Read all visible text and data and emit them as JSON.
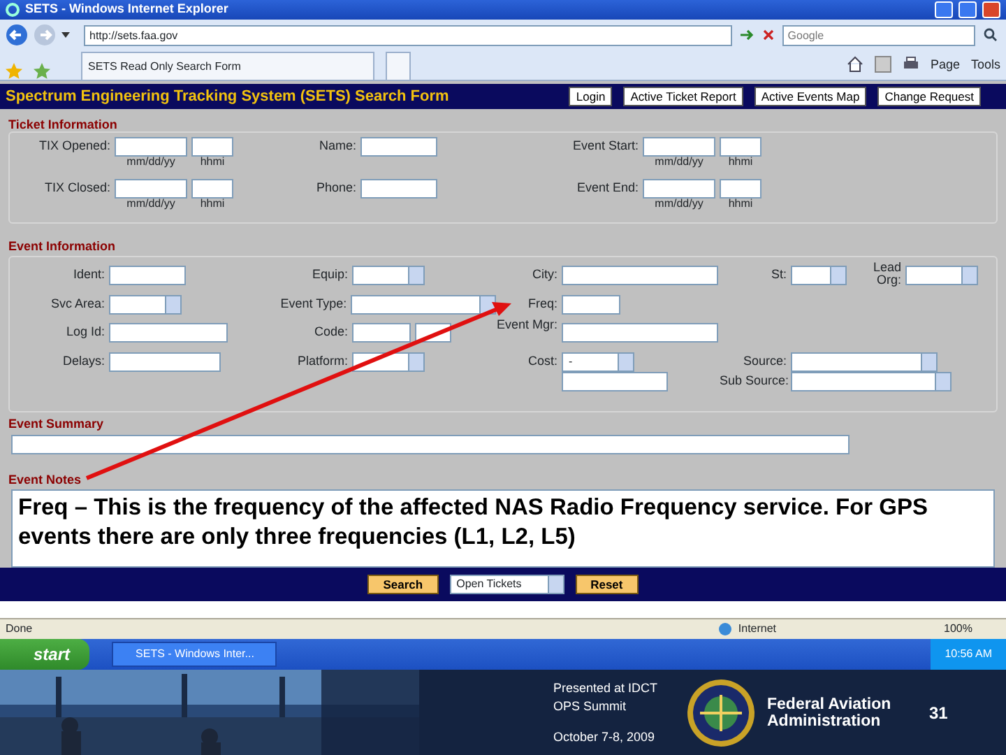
{
  "window": {
    "title": "SETS - Windows Internet Explorer",
    "address": "http://sets.faa.gov",
    "search_placeholder": "Google",
    "tab": "SETS Read Only Search Form",
    "toolbar": [
      "Page",
      "Tools"
    ]
  },
  "header": {
    "title": "Spectrum Engineering Tracking System (SETS) Search Form",
    "buttons": [
      "Login",
      "Active Ticket Report",
      "Active Events Map",
      "Change Request"
    ]
  },
  "ticket_information": {
    "title": "Ticket Information",
    "rows": [
      [
        {
          "label": "TIX Opened:",
          "kind": "datetime",
          "hints": [
            "mm/dd/yy",
            "hhmi"
          ]
        },
        {
          "label": "Name:",
          "kind": "text"
        },
        {
          "label": "Event Start:",
          "kind": "datetime",
          "hints": [
            "mm/dd/yy",
            "hhmi"
          ]
        }
      ],
      [
        {
          "label": "TIX Closed:",
          "kind": "datetime",
          "hints": [
            "mm/dd/yy",
            "hhmi"
          ]
        },
        {
          "label": "Phone:",
          "kind": "text"
        },
        {
          "label": "Event End:",
          "kind": "datetime",
          "hints": [
            "mm/dd/yy",
            "hhmi"
          ]
        }
      ]
    ]
  },
  "event_information": {
    "title": "Event Information",
    "rows": [
      [
        {
          "label": "Ident:",
          "kind": "text"
        },
        {
          "label": "Equip:",
          "kind": "select"
        },
        {
          "label": "City:",
          "kind": "wide"
        },
        {
          "label": "St:",
          "kind": "small-select"
        },
        {
          "label": "Lead Org:",
          "kind": "select"
        }
      ],
      [
        {
          "label": "Svc Area:",
          "kind": "select"
        },
        {
          "label": "Event Type:",
          "kind": "wide-select"
        },
        {
          "label": "Freq:",
          "kind": "small"
        }
      ],
      [
        {
          "label": "Log Id:",
          "kind": "wide"
        },
        {
          "label": "Code:",
          "kind": "pair"
        },
        {
          "label": "Event Mgr:",
          "kind": "wide"
        }
      ],
      [
        {
          "label": "Delays:",
          "kind": "wide"
        },
        {
          "label": "Platform:",
          "kind": "select"
        },
        {
          "label": "Cost:",
          "kind": "cost",
          "value": "-"
        },
        {
          "kind": "stacked",
          "items": [
            {
              "label": "Source:",
              "kind": "wide-select"
            },
            {
              "label": "Sub Source:",
              "kind": "wide-select"
            }
          ]
        }
      ]
    ]
  },
  "event_summary": {
    "title": "Event Summary"
  },
  "event_notes": {
    "title": "Event Notes",
    "text": "Freq – This is the frequency of the affected NAS Radio Frequency service. For GPS events there are only three frequencies (L1, L2, L5)"
  },
  "actions": {
    "search": "Search",
    "filter": "Open Tickets",
    "reset": "Reset"
  },
  "status_bar": {
    "status": "Done",
    "zone": "Internet",
    "zoom": "100%"
  },
  "taskbar": {
    "start": "start",
    "task": "SETS - Windows Inter...",
    "clock": "10:56 AM"
  },
  "slide_footer": {
    "presented": "Presented at IDCT OPS Summit",
    "date": "October 7-8, 2009",
    "agency": "Federal Aviation Administration",
    "page": "31"
  }
}
